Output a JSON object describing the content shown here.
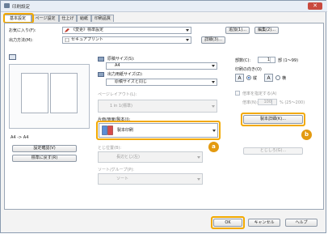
{
  "window": {
    "title": "印刷設定",
    "close_label": "✕"
  },
  "tabs": [
    "基本設定",
    "ページ設定",
    "仕上げ",
    "給紙",
    "印刷品質"
  ],
  "left": {
    "favorites_label": "お気に入り(F):",
    "favorites_value": "《変更》標準設定",
    "add_button": "追加(1)...",
    "edit_button": "編集(2)...",
    "output_label": "出力方法(M):",
    "output_value": "セキュアプリント",
    "detail_button": "詳細(3)...",
    "preview_caption": "A4 -> A4",
    "confirm_settings_button": "設定確認(V)",
    "restore_defaults_button": "標準に戻す(R)"
  },
  "middle": {
    "paper_size_label": "原稿サイズ(S):",
    "paper_size_value": "A4",
    "output_size_label": "出力用紙サイズ(Z):",
    "output_size_value": "原稿サイズと同じ",
    "page_layout_label": "ページレイアウト(L):",
    "page_layout_value": "1 in 1(標準)",
    "duplex_label": "片面/両面/製本(I):",
    "duplex_value": "製本印刷",
    "binding_label": "とじ位置(B):",
    "binding_value": "長辺とじ(左)",
    "sort_label": "ソート/グループ(P):",
    "sort_value": "ソート"
  },
  "right": {
    "copies_label": "部数(C):",
    "copies_value": "1",
    "copies_unit": "部 (1～99)",
    "orientation_label": "印刷の向き(O)",
    "portrait_label": "縦",
    "landscape_label": "横",
    "scale_checkbox_label": "倍率を指定する(A)",
    "scale_label": "倍率(N):",
    "scale_value": "100",
    "scale_range": "% (25～200)",
    "booklet_detail_button": "製本詳細(K)...",
    "binding_margin_button": "とじしろ(G)..."
  },
  "footer": {
    "ok": "OK",
    "cancel": "キャンセル",
    "help": "ヘルプ"
  },
  "badges": {
    "a": "a",
    "b": "b"
  },
  "colors": {
    "highlight": "#f2a900",
    "badge": "#e39a10"
  }
}
